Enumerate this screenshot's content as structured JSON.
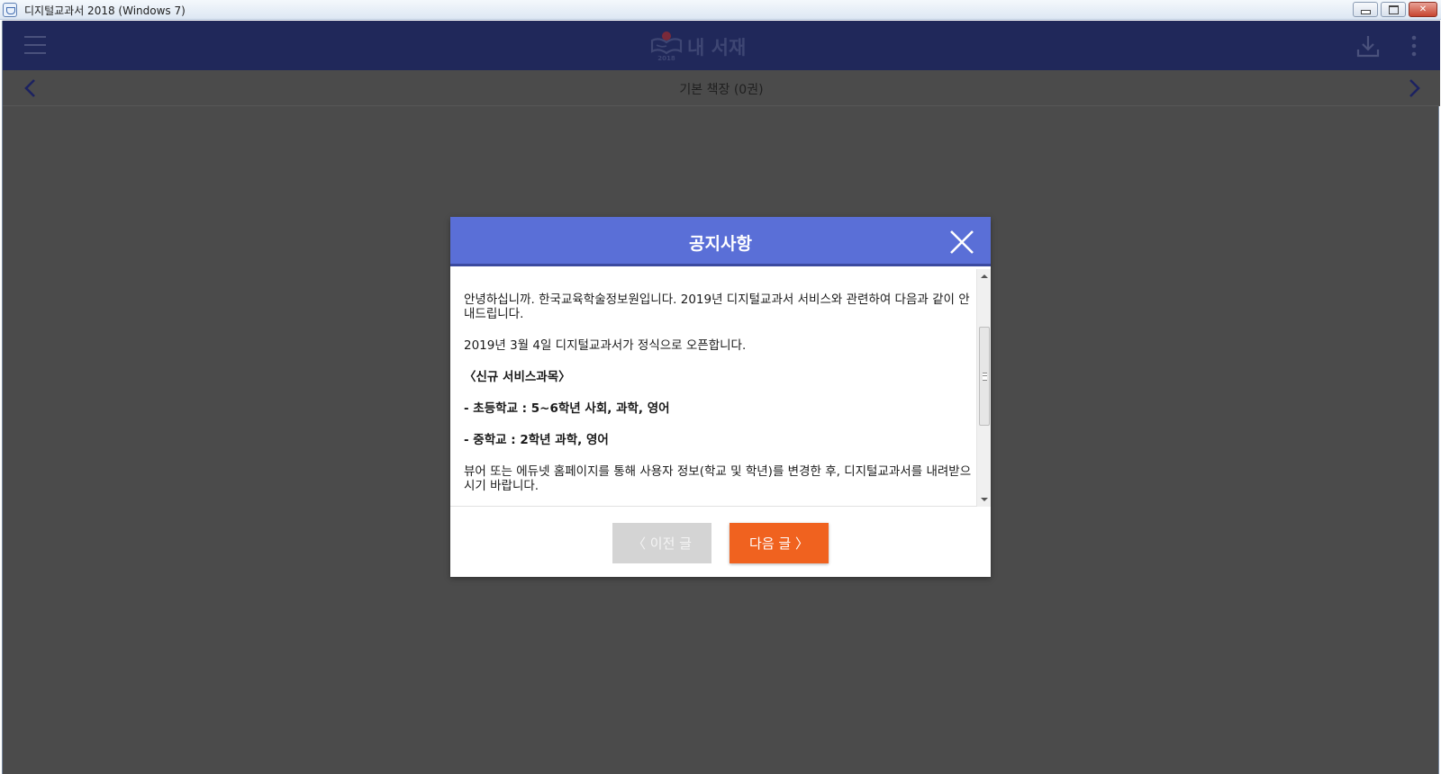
{
  "window": {
    "title": "디지털교과서 2018 (Windows 7)",
    "icon": "app-icon"
  },
  "header": {
    "logo_text": "내 서재",
    "logo_year": "2018",
    "menu_icon": "hamburger-icon",
    "download_icon": "download-icon",
    "more_icon": "more-vertical-icon"
  },
  "subheader": {
    "shelf_title": "기본 책장 (0권)"
  },
  "dialog": {
    "title": "공지사항",
    "paragraphs": [
      "안녕하십니까. 한국교육학술정보원입니다. 2019년 디지털교과서 서비스와 관련하여 다음과 같이 안내드립니다.",
      "2019년 3월 4일 디지털교과서가 정식으로 오픈합니다.",
      "〈신규 서비스과목〉",
      "- 초등학교 : 5~6학년 사회, 과학, 영어",
      "- 중학교 : 2학년 과학, 영어",
      "뷰어 또는 에듀넷 홈페이지를 통해 사용자 정보(학교 및 학년)를 변경한 후, 디지털교과서를 내려받으시기 바랍니다."
    ],
    "prev_button": "〈 이전 글",
    "next_button": "다음 글 〉"
  },
  "colors": {
    "header_bg": "#20285a",
    "dialog_header_bg": "#5a6fd7",
    "next_button_bg": "#f0621f",
    "prev_button_bg": "#d4d4d4",
    "backdrop": "#4b4b4b"
  }
}
